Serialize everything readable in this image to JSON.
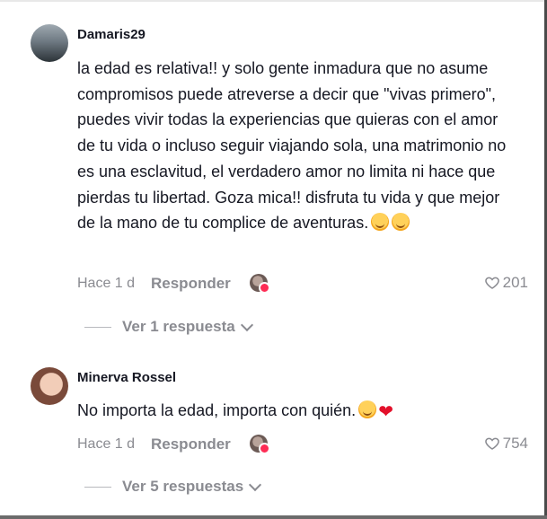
{
  "comments": [
    {
      "username": "Damaris29",
      "text": "la edad es relativa!! y solo gente inmadura que no asume compromisos puede atreverse a decir que \"vivas primero\", puedes vivir todas la experiencias que quieras con el amor de tu vida o incluso seguir viajando sola, una matrimonio no es una esclavitud, el verdadero amor no limita ni hace que pierdas tu libertad. Goza mica!! disfruta tu vida y que mejor de la mano de tu complice de aventuras.",
      "emojis": [
        "smiling-face-with-hearts-emoji",
        "smiling-face-with-hearts-emoji"
      ],
      "time": "Hace 1 d",
      "reply_label": "Responder",
      "likes": "201",
      "replies_label": "Ver 1 respuesta"
    },
    {
      "username": "Minerva Rossel",
      "text": "No importa la edad, importa con quién.",
      "emojis": [
        "smiling-face-with-hearts-emoji",
        "red-heart-emoji"
      ],
      "time": "Hace 1 d",
      "reply_label": "Responder",
      "likes": "754",
      "replies_label": "Ver 5 respuestas"
    }
  ],
  "colors": {
    "text": "#161823",
    "muted": "#8a8b91",
    "accent": "#fe2c55"
  }
}
